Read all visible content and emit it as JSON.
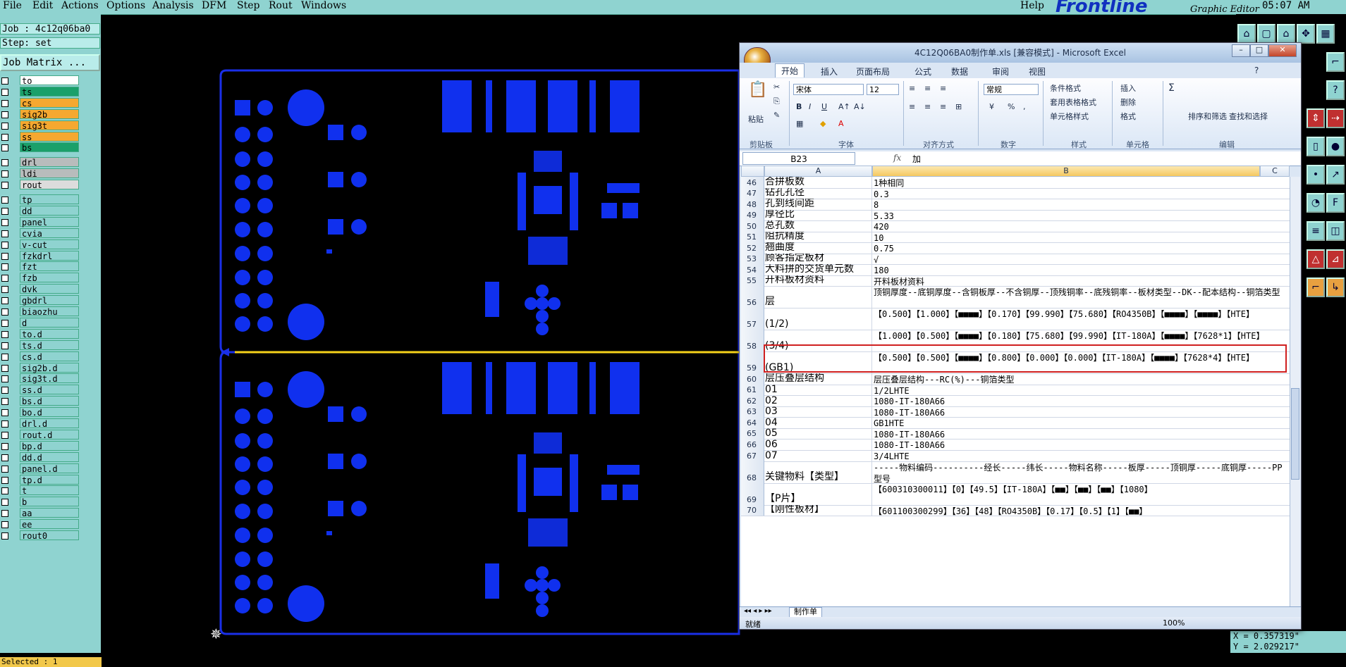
{
  "menubar": {
    "items": [
      "File",
      "Edit",
      "Actions",
      "Options",
      "Analysis",
      "DFM",
      "Step",
      "Rout",
      "Windows"
    ],
    "help": "Help",
    "brand": "Frontline",
    "brand_sub": "Graphic Editor",
    "clock": "05:07 AM"
  },
  "left_panel": {
    "job": "Job : 4c12q06ba0",
    "step": "Step: set",
    "job_matrix": "Job Matrix ...",
    "selected": "Selected : 1",
    "layers": [
      {
        "name": "to",
        "color": "#ffffff"
      },
      {
        "name": "ts",
        "color": "#1aa06a"
      },
      {
        "name": "cs",
        "color": "#f5a830"
      },
      {
        "name": "sig2b",
        "color": "#f5a830"
      },
      {
        "name": "sig3t",
        "color": "#f5a830"
      },
      {
        "name": "ss",
        "color": "#f5a830"
      },
      {
        "name": "bs",
        "color": "#1aa06a"
      },
      {
        "name": "drl",
        "color": "#b8bcbc"
      },
      {
        "name": "ldi",
        "color": "#b8bcbc"
      },
      {
        "name": "rout",
        "color": "#dcdcdc"
      },
      {
        "name": "tp",
        "color": "#8fd3d0"
      },
      {
        "name": "dd",
        "color": "#8fd3d0"
      },
      {
        "name": "panel",
        "color": "#8fd3d0"
      },
      {
        "name": "cvia",
        "color": "#8fd3d0"
      },
      {
        "name": "v-cut",
        "color": "#8fd3d0"
      },
      {
        "name": "fzkdrl",
        "color": "#8fd3d0"
      },
      {
        "name": "fzt",
        "color": "#8fd3d0"
      },
      {
        "name": "fzb",
        "color": "#8fd3d0"
      },
      {
        "name": "dvk",
        "color": "#8fd3d0"
      },
      {
        "name": "gbdrl",
        "color": "#8fd3d0"
      },
      {
        "name": "biaozhu",
        "color": "#8fd3d0"
      },
      {
        "name": "d",
        "color": "#8fd3d0"
      },
      {
        "name": "to.d",
        "color": "#8fd3d0"
      },
      {
        "name": "ts.d",
        "color": "#8fd3d0"
      },
      {
        "name": "cs.d",
        "color": "#8fd3d0"
      },
      {
        "name": "sig2b.d",
        "color": "#8fd3d0"
      },
      {
        "name": "sig3t.d",
        "color": "#8fd3d0"
      },
      {
        "name": "ss.d",
        "color": "#8fd3d0"
      },
      {
        "name": "bs.d",
        "color": "#8fd3d0"
      },
      {
        "name": "bo.d",
        "color": "#8fd3d0"
      },
      {
        "name": "drl.d",
        "color": "#8fd3d0"
      },
      {
        "name": "rout.d",
        "color": "#8fd3d0"
      },
      {
        "name": "bp.d",
        "color": "#8fd3d0"
      },
      {
        "name": "dd.d",
        "color": "#8fd3d0"
      },
      {
        "name": "panel.d",
        "color": "#8fd3d0"
      },
      {
        "name": "tp.d",
        "color": "#8fd3d0"
      },
      {
        "name": "t",
        "color": "#8fd3d0"
      },
      {
        "name": "b",
        "color": "#8fd3d0"
      },
      {
        "name": "aa",
        "color": "#8fd3d0"
      },
      {
        "name": "ee",
        "color": "#8fd3d0"
      },
      {
        "name": "rout0",
        "color": "#8fd3d0"
      }
    ]
  },
  "coords": {
    "x": "X = 0.357319\"",
    "y": "Y = 2.029217\""
  },
  "excel": {
    "title": "4C12Q06BA0制作单.xls [兼容模式] - Microsoft Excel",
    "tabs": [
      "开始",
      "插入",
      "页面布局",
      "公式",
      "数据",
      "审阅",
      "视图"
    ],
    "ribbon": {
      "paste": "粘贴",
      "font_name": "宋体",
      "font_size": "12",
      "number_format": "常规",
      "cond_format": "条件格式",
      "table_format": "套用表格格式",
      "cell_style": "单元格样式",
      "insert": "插入",
      "delete": "删除",
      "format": "格式",
      "sort_filter": "排序和筛选",
      "find_select": "查找和选择",
      "groups": [
        "剪贴板",
        "字体",
        "对齐方式",
        "数字",
        "样式",
        "单元格",
        "编辑"
      ]
    },
    "name_box": "B23",
    "fx": "fx",
    "formula_value": "加",
    "col_headers": [
      "A",
      "B",
      "C"
    ],
    "rows": [
      {
        "n": "46",
        "a": "合拼板数",
        "b": "1种相同",
        "h": 16
      },
      {
        "n": "47",
        "a": "钻孔孔径",
        "b": "0.3",
        "h": 16
      },
      {
        "n": "48",
        "a": "孔到线间距",
        "b": "8",
        "h": 16
      },
      {
        "n": "49",
        "a": "厚径比",
        "b": "5.33",
        "h": 16
      },
      {
        "n": "50",
        "a": "总孔数",
        "b": "420",
        "h": 16
      },
      {
        "n": "51",
        "a": "阻抗精度",
        "b": "10",
        "h": 16
      },
      {
        "n": "52",
        "a": "翘曲度",
        "b": "0.75",
        "h": 16
      },
      {
        "n": "53",
        "a": "顾客指定板材",
        "b": "√",
        "h": 16
      },
      {
        "n": "54",
        "a": "大料拼的交货单元数",
        "b": "180",
        "h": 16
      },
      {
        "n": "55",
        "a": "开料板材资料",
        "b": "开料板材资料",
        "h": 16
      },
      {
        "n": "56",
        "a": "层",
        "b": "顶铜厚度--底铜厚度--含铜板厚--不含铜厚--顶残铜率--底残铜率--板材类型--DK--配本结构--铜箔类型",
        "h": 32
      },
      {
        "n": "57",
        "a": "(1/2)",
        "b": "【0.500】【1.000】【■■■■】【0.170】【99.990】【75.680】【RO4350B】【■■■■】【■■■■】【HTE】",
        "h": 32
      },
      {
        "n": "58",
        "a": "(3/4)",
        "b": "【1.000】【0.500】【■■■■】【0.180】【75.680】【99.990】【IT-180A】【■■■■】【7628*1】【HTE】",
        "h": 32
      },
      {
        "n": "59",
        "a": "(GB1)",
        "b": "【0.500】【0.500】【■■■■】【0.800】【0.000】【0.000】【IT-180A】【■■■■】【7628*4】【HTE】",
        "h": 32
      },
      {
        "n": "60",
        "a": "层压叠层结构",
        "b": "层压叠层结构---RC(%)---铜箔类型",
        "h": 16
      },
      {
        "n": "61",
        "a": "01",
        "b": "1/2LHTE",
        "h": 16
      },
      {
        "n": "62",
        "a": "02",
        "b": "1080-IT-180A66",
        "h": 16
      },
      {
        "n": "63",
        "a": "03",
        "b": "1080-IT-180A66",
        "h": 16
      },
      {
        "n": "64",
        "a": "04",
        "b": "GB1HTE",
        "h": 16
      },
      {
        "n": "65",
        "a": "05",
        "b": "1080-IT-180A66",
        "h": 16
      },
      {
        "n": "66",
        "a": "06",
        "b": "1080-IT-180A66",
        "h": 16
      },
      {
        "n": "67",
        "a": "07",
        "b": "3/4LHTE",
        "h": 16
      },
      {
        "n": "68",
        "a": "关键物料【类型】",
        "b": "-----物料编码----------经长-----纬长-----物料名称-----板厚-----顶铜厚-----底铜厚-----PP型号",
        "h": 32
      },
      {
        "n": "69",
        "a": "【P片】",
        "b": "【600310300011】【0】【49.5】【IT-180A】【■■】【■■】【■■】【1080】",
        "h": 32
      },
      {
        "n": "70",
        "a": "【刚性板材】",
        "b": "【601100300299】【36】【48】【RO4350B】【0.17】【0.5】【1】【■■】",
        "h": 16
      }
    ],
    "sheet_tab": "制作单",
    "status": "就绪",
    "zoom": "100%"
  }
}
